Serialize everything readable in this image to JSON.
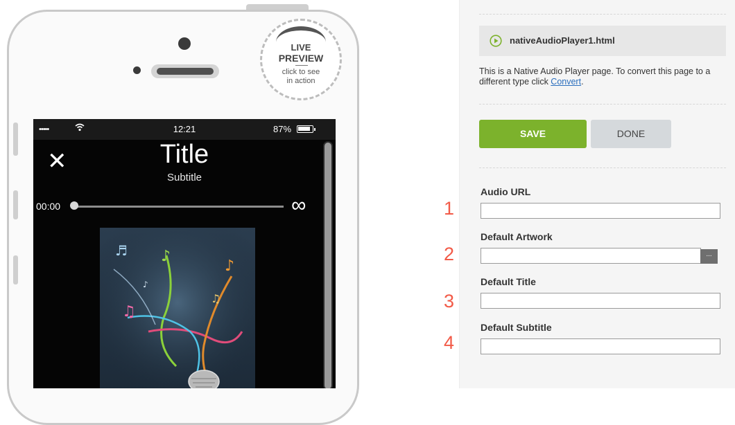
{
  "phone": {
    "badge": {
      "line1": "LIVE",
      "line2": "PREVIEW",
      "caption1": "click to see",
      "caption2": "in action"
    },
    "status_bar": {
      "signal": "•••••",
      "time": "12:21",
      "battery": "87%"
    },
    "player": {
      "close": "✕",
      "title": "Title",
      "subtitle": "Subtitle",
      "elapsed": "00:00",
      "progress": 0.0,
      "loop_icon": "∞"
    }
  },
  "editor": {
    "file_name": "nativeAudioPlayer1.html",
    "description": "This is a Native Audio Player page. To convert this page to a different type click ",
    "convert_link": "Convert",
    "description_end": ".",
    "save_label": "SAVE",
    "done_label": "DONE",
    "fields": [
      {
        "label": "Audio URL",
        "value": ""
      },
      {
        "label": "Default Artwork",
        "value": "",
        "browse": "..."
      },
      {
        "label": "Default Title",
        "value": ""
      },
      {
        "label": "Default Subtitle",
        "value": ""
      }
    ]
  },
  "annotations": [
    "1",
    "2",
    "3",
    "4"
  ],
  "colors": {
    "accent_green": "#7cb22c",
    "annotation_red": "#f25a47",
    "link_blue": "#2a6ebd",
    "panel_bg": "#f5f5f5"
  }
}
